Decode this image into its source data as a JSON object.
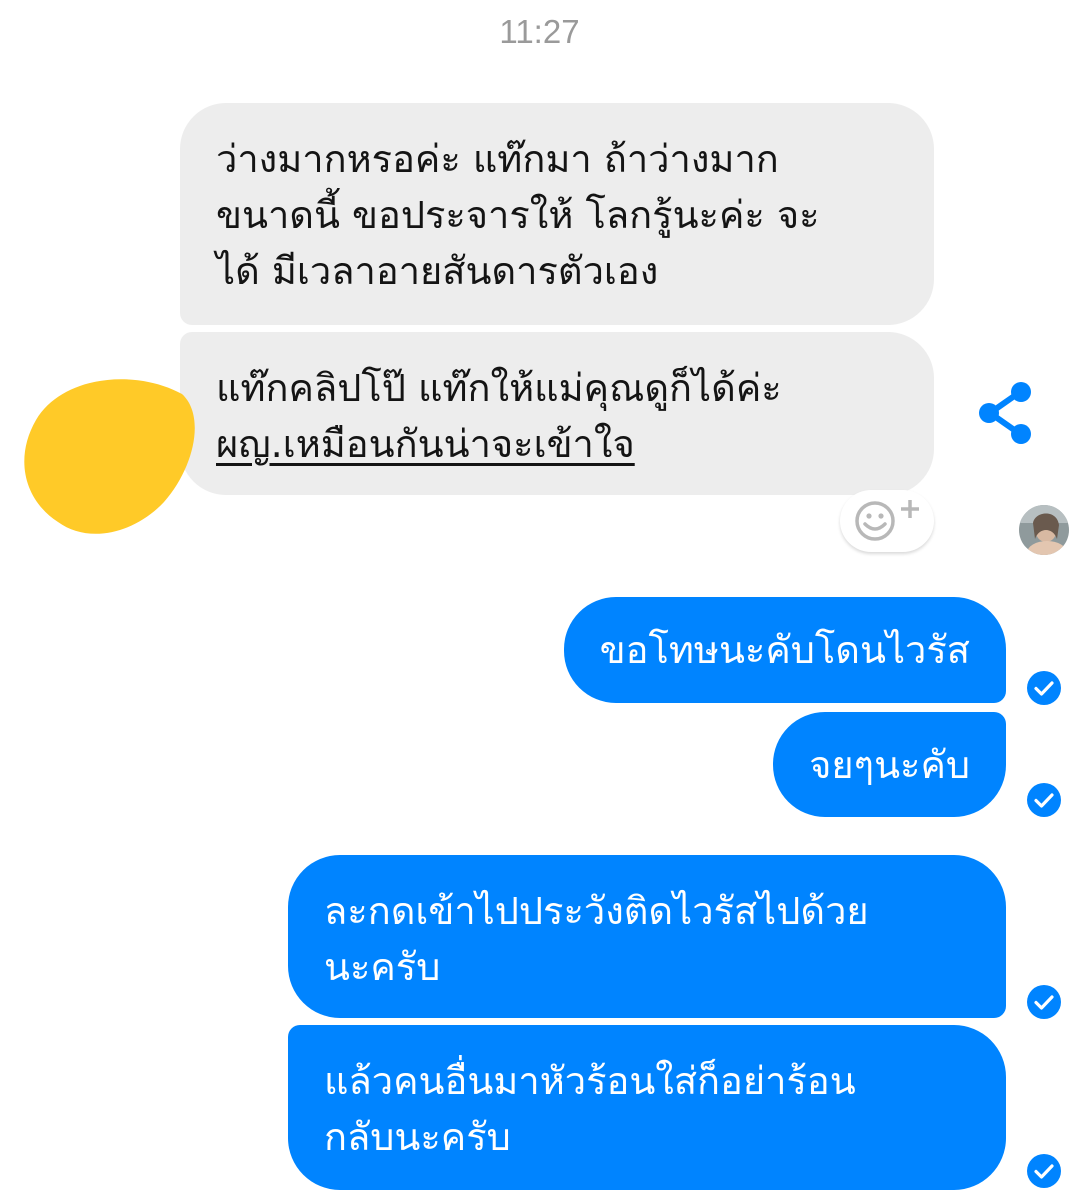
{
  "conversation": {
    "timestamp": "11:27",
    "incoming": [
      {
        "lines": [
          "ว่างมากหรอค่ะ แท๊กมา ถ้าว่างมาก",
          "ขนาดนี้ ขอประจารให้ โลกรู้นะค่ะ จะ",
          "ได้ มีเวลาอายสันดารตัวเอง"
        ]
      },
      {
        "lines": [
          "แท๊กคลิปโป๊ แท๊กให้แม่คุณดูก็ได้ค่ะ",
          "ผญ.เหมือนกันน่าจะเข้าใจ"
        ]
      }
    ],
    "outgoing": [
      {
        "lines": [
          "ขอโทษนะคับโดนไวรัส"
        ]
      },
      {
        "lines": [
          "จยๆนะคับ"
        ]
      },
      {
        "lines": [
          "ละกดเข้าไปประวังติดไวรัสไปด้วย",
          "นะครับ"
        ]
      },
      {
        "lines": [
          "แล้วคนอื่นมาหัวร้อนใส่ก็อย่าร้อน",
          "กลับนะครับ"
        ]
      }
    ]
  },
  "icons": {
    "share": "share-icon",
    "react": "add-reaction-icon",
    "delivered": "check-circle-icon",
    "redaction": "yellow-scribble"
  },
  "colors": {
    "incoming_bubble": "#ededed",
    "outgoing_bubble": "#0084ff",
    "accent": "#0084ff",
    "timestamp": "#9a9a9a",
    "redaction": "#ffca28"
  }
}
